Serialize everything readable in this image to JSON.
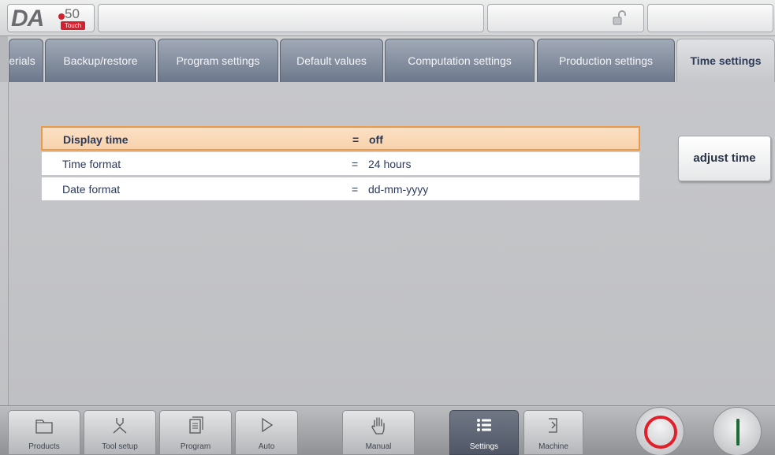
{
  "logo": {
    "brand": "DA",
    "model": "50",
    "edition": "Touch"
  },
  "tabs": [
    {
      "label": "erials"
    },
    {
      "label": "Backup/restore"
    },
    {
      "label": "Program settings"
    },
    {
      "label": "Default values"
    },
    {
      "label": "Computation settings"
    },
    {
      "label": "Production settings"
    },
    {
      "label": "Time settings"
    }
  ],
  "settings": [
    {
      "label": "Display time",
      "eq": "=",
      "value": "off"
    },
    {
      "label": "Time format",
      "eq": "=",
      "value": "24 hours"
    },
    {
      "label": "Date format",
      "eq": "=",
      "value": "dd-mm-yyyy"
    }
  ],
  "actions": {
    "adjust_time": "adjust time"
  },
  "nav": [
    {
      "label": "Products",
      "icon": "folder-icon"
    },
    {
      "label": "Tool setup",
      "icon": "tool-icon"
    },
    {
      "label": "Program",
      "icon": "program-icon"
    },
    {
      "label": "Auto",
      "icon": "play-icon"
    },
    {
      "label": "Manual",
      "icon": "hand-icon"
    },
    {
      "label": "Settings",
      "icon": "settings-list-icon"
    },
    {
      "label": "Machine",
      "icon": "machine-icon"
    }
  ],
  "colors": {
    "accent_active_tab": "#2d3b5a",
    "selected_row": "#f7d2ad",
    "stop": "#e2202c",
    "start": "#1e6b3a"
  }
}
